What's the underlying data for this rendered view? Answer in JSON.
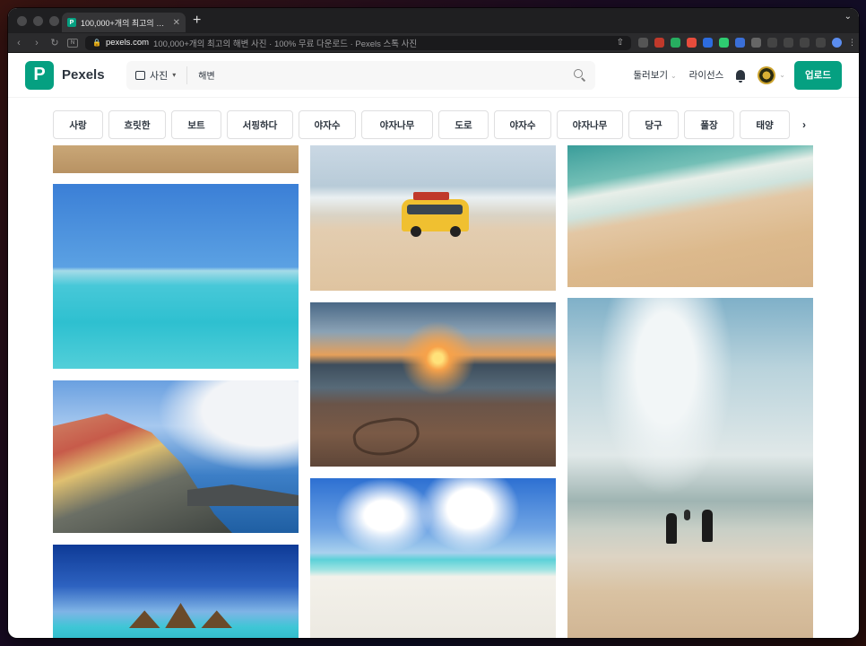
{
  "browser": {
    "tab_title": "100,000+개의 최고의 해변 사진 · 10",
    "url_host": "pexels.com",
    "url_rest": "100,000+개의 최고의 해변 사진 · 100% 무료 다운로드 · Pexels 스톡 사진",
    "favicon_letter": "P"
  },
  "header": {
    "logo_letter": "P",
    "logo_text": "Pexels",
    "search_type": "사진",
    "search_value": "해변",
    "nav_explore": "둘러보기",
    "nav_license": "라이선스",
    "upload_label": "업로드"
  },
  "tags": [
    "사랑",
    "흐릿한",
    "보트",
    "서핑하다",
    "야자수",
    "야자나무",
    "도로",
    "야자수",
    "야자나무",
    "당구",
    "풀장",
    "태양"
  ],
  "colors": {
    "brand": "#05a081",
    "text": "#2c343e"
  },
  "photos": [
    {
      "name": "photo-sand-top",
      "desc": "sand"
    },
    {
      "name": "photo-turquoise-sea",
      "desc": "turquoise sea"
    },
    {
      "name": "photo-cinque-terre",
      "desc": "cliff village"
    },
    {
      "name": "photo-overwater-bungalow",
      "desc": "bungalow"
    },
    {
      "name": "photo-toy-van",
      "desc": "toy van beach"
    },
    {
      "name": "photo-sunset-heart",
      "desc": "sunset heart"
    },
    {
      "name": "photo-white-sand",
      "desc": "white sand"
    },
    {
      "name": "photo-aerial-wave",
      "desc": "aerial wave"
    },
    {
      "name": "photo-people-running",
      "desc": "people running into sea"
    }
  ]
}
